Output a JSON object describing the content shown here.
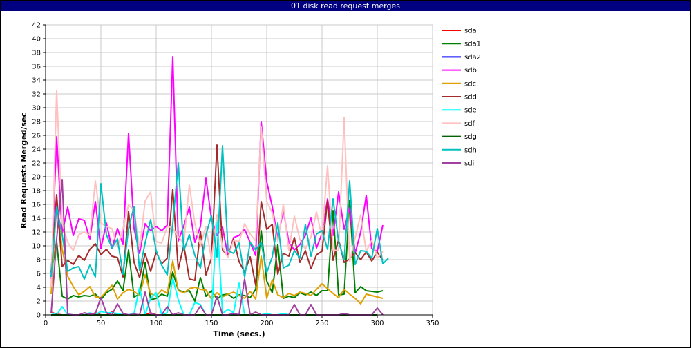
{
  "window": {
    "title": "01 disk read request merges"
  },
  "chart_data": {
    "type": "line",
    "title": "01 disk read request merges",
    "xlabel": "Time (secs.)",
    "ylabel": "Read Requests Merged/sec",
    "xlim": [
      0,
      350
    ],
    "ylim": [
      0,
      42
    ],
    "xticks": [
      0,
      50,
      100,
      150,
      200,
      250,
      300,
      350
    ],
    "yticks": [
      0,
      2,
      4,
      6,
      8,
      10,
      12,
      14,
      16,
      18,
      20,
      22,
      24,
      26,
      28,
      30,
      32,
      34,
      36,
      38,
      40,
      42
    ],
    "grid": true,
    "legend": "right",
    "x": [
      5,
      10,
      15,
      20,
      25,
      30,
      35,
      40,
      45,
      50,
      55,
      60,
      65,
      70,
      75,
      80,
      85,
      90,
      95,
      100,
      105,
      110,
      115,
      120,
      125,
      130,
      135,
      140,
      145,
      150,
      155,
      160,
      165,
      170,
      175,
      180,
      185,
      190,
      195,
      200,
      205,
      210,
      215,
      220,
      225,
      230,
      235,
      240,
      245,
      250,
      255,
      260,
      265,
      270,
      275,
      280,
      285,
      290,
      295,
      300,
      305,
      310
    ],
    "series": [
      {
        "name": "sda",
        "color": "#ff0000",
        "values": [
          0.4,
          0.1,
          0,
          0,
          0,
          0,
          0,
          0,
          0.3,
          0,
          0,
          0.4,
          0,
          0,
          0,
          0.1,
          0,
          0,
          0.3,
          0,
          0,
          0,
          0,
          0,
          0,
          0,
          0,
          0,
          0,
          0,
          0,
          0,
          0,
          0,
          0,
          0,
          0,
          0,
          0,
          0,
          0,
          0,
          0,
          0,
          0,
          0,
          0,
          0,
          0,
          0,
          0,
          0,
          0,
          0,
          0,
          0,
          0,
          0,
          0,
          0,
          null,
          null
        ]
      },
      {
        "name": "sda1",
        "color": "#008000",
        "values": [
          6,
          10.6,
          2.7,
          2.3,
          2.8,
          2.6,
          2.8,
          2.7,
          3,
          2.2,
          3.2,
          3.7,
          4.9,
          3.5,
          9.4,
          2.6,
          3,
          7.6,
          2.2,
          2.4,
          3,
          2.7,
          6.2,
          3.6,
          3.3,
          3.5,
          2,
          5.4,
          2.7,
          3.5,
          2.3,
          2.9,
          3,
          2.4,
          2.9,
          2.8,
          2.5,
          3.7,
          12.2,
          4.9,
          3.2,
          10.2,
          2.4,
          2.7,
          2.5,
          3.2,
          2.9,
          3.3,
          2.8,
          3.5,
          3.5,
          15.1,
          2.9,
          3,
          16.6,
          3.2,
          4.1,
          3.5,
          3.4,
          3.3,
          3.5,
          null
        ]
      },
      {
        "name": "sda2",
        "color": "#0000ff",
        "values": [
          0,
          0,
          0,
          0,
          0,
          0,
          0,
          0,
          0,
          0,
          0,
          0,
          0,
          0,
          0,
          0,
          0,
          0,
          0,
          0,
          0,
          0,
          0,
          0,
          0,
          0,
          0,
          0,
          0,
          0,
          0,
          0,
          0,
          0,
          0,
          0,
          0,
          0,
          0,
          0,
          0,
          0,
          0,
          0,
          0,
          0,
          0,
          0,
          0,
          0,
          0,
          0,
          0,
          0,
          0,
          0,
          0,
          0,
          0,
          0,
          null,
          null
        ]
      },
      {
        "name": "sdb",
        "color": "#ff00ff",
        "values": [
          5.2,
          25.8,
          11.8,
          15.6,
          11.5,
          13.9,
          13.7,
          11,
          16.4,
          9.6,
          13.3,
          9.6,
          12.5,
          10.2,
          26.3,
          12.5,
          8.9,
          13.2,
          12.2,
          12.8,
          12.2,
          13,
          37.4,
          10.7,
          12.9,
          15.6,
          10.5,
          12.8,
          19.8,
          13.9,
          11.5,
          12.7,
          8.4,
          11.2,
          11.5,
          12.4,
          10.5,
          8.6,
          28,
          19.3,
          15.7,
          11,
          15.2,
          10.5,
          9.4,
          10.2,
          11.5,
          14.1,
          9.7,
          11.8,
          16.8,
          11.5,
          17.8,
          12.4,
          15.5,
          8.9,
          12,
          17.3,
          9.6,
          9.2,
          13,
          null
        ]
      },
      {
        "name": "sdc",
        "color": "#e0a000",
        "values": [
          3,
          16.5,
          9.5,
          5.6,
          4.1,
          2.9,
          3.4,
          4.1,
          2.6,
          2.5,
          3.4,
          4.3,
          2.3,
          3.2,
          3.7,
          3.4,
          2.8,
          5.8,
          3.1,
          2.7,
          3.6,
          3.1,
          7.8,
          3.5,
          3.2,
          3.8,
          4,
          3.7,
          3.6,
          2.3,
          3.2,
          2.6,
          3,
          3.3,
          2.8,
          2.4,
          3.4,
          2.3,
          8.5,
          2.4,
          5.1,
          2.9,
          2.5,
          3.1,
          2.8,
          3.3,
          3.1,
          2.8,
          3.7,
          4.5,
          3.8,
          3.1,
          2.5,
          3.7,
          3,
          2.4,
          1.6,
          3,
          2.8,
          2.6,
          2.4,
          null
        ]
      },
      {
        "name": "sdd",
        "color": "#a52a2a",
        "values": [
          6.2,
          17.4,
          7,
          7.9,
          7.3,
          8.6,
          7.9,
          9.5,
          10.3,
          8.7,
          9.5,
          8.5,
          8.3,
          5.5,
          15,
          7.6,
          5.4,
          8.9,
          6.3,
          9.1,
          7.4,
          8.2,
          18.2,
          6.6,
          10.1,
          5.2,
          5,
          12.1,
          5.8,
          8.2,
          24.6,
          9.4,
          8.5,
          11,
          7.7,
          6.2,
          8.4,
          4.3,
          16.4,
          12.4,
          13.1,
          5.9,
          8.9,
          8.5,
          11.2,
          7.6,
          9.3,
          6.7,
          8.7,
          9.2,
          16.5,
          7.9,
          10.9,
          7.6,
          8.1,
          9,
          8,
          9.1,
          7.8,
          9.1,
          7.9,
          null
        ]
      },
      {
        "name": "sde",
        "color": "#00ffff",
        "values": [
          0.3,
          0,
          1.2,
          0,
          0,
          0,
          0,
          0.3,
          0,
          0.5,
          0.3,
          0.3,
          0.2,
          0,
          0,
          0.2,
          4,
          0,
          2.4,
          3.2,
          0,
          0.3,
          5.3,
          2.2,
          0,
          0,
          1.8,
          1.5,
          0,
          0,
          14.2,
          0.2,
          0.8,
          0.3,
          4.6,
          0,
          0,
          0,
          0,
          0.2,
          0,
          0,
          0.2,
          0,
          0,
          0,
          0,
          0,
          0,
          0,
          0,
          0,
          0,
          0,
          0,
          0,
          0,
          0,
          0,
          0,
          null,
          null
        ]
      },
      {
        "name": "sdf",
        "color": "#ffc0c0",
        "values": [
          4.1,
          32.5,
          13.3,
          10.5,
          9.3,
          11.6,
          12,
          11.5,
          19.4,
          13.3,
          12.8,
          12.5,
          9.8,
          12.5,
          15.9,
          15.2,
          9.5,
          16.5,
          17.8,
          10.6,
          10.4,
          12.8,
          12.6,
          11.3,
          10.4,
          18.8,
          13.2,
          10,
          12.8,
          8,
          14.5,
          9.8,
          8.3,
          10.8,
          10.6,
          13.2,
          11.7,
          10.7,
          27.2,
          16.4,
          14.8,
          10.6,
          16,
          9.3,
          14.3,
          10.9,
          9.5,
          11.3,
          14.9,
          11.2,
          21.6,
          9.4,
          9.3,
          28.6,
          7.7,
          11.2,
          14.5,
          9.2,
          10.8,
          8.2,
          9.2,
          null
        ]
      },
      {
        "name": "sdg",
        "color": "#006400",
        "values": [
          0,
          0,
          0,
          0,
          0,
          0,
          0,
          0,
          0,
          0,
          0,
          0,
          0,
          0,
          0,
          0,
          0,
          0,
          0,
          0,
          0,
          0,
          0,
          0,
          0,
          0,
          0,
          0,
          0,
          0,
          0,
          0,
          0,
          0,
          0,
          0,
          0,
          0,
          0,
          0,
          0,
          0,
          0,
          0,
          0,
          0,
          0,
          0,
          0,
          0,
          0,
          0,
          0,
          0,
          0,
          0,
          0,
          0,
          0,
          0,
          null,
          null
        ]
      },
      {
        "name": "sdh",
        "color": "#00c0c0",
        "values": [
          5.5,
          15.7,
          11.6,
          6.3,
          6.8,
          7,
          5.2,
          7.2,
          5.5,
          19,
          11.6,
          9.7,
          11,
          5.9,
          12.5,
          15.7,
          6.4,
          10.4,
          13.8,
          9.3,
          7.2,
          5.8,
          13.2,
          22,
          9.3,
          11.6,
          8.6,
          6.8,
          11.6,
          14.4,
          8.4,
          24.5,
          9.3,
          8.9,
          10.4,
          5.5,
          10.5,
          9.4,
          10.5,
          6.1,
          8.4,
          13.3,
          6.8,
          7.2,
          9.3,
          8.2,
          13.1,
          8.5,
          11.7,
          12.2,
          9.5,
          16.8,
          10.6,
          8,
          19.4,
          7.3,
          9.3,
          9.2,
          8.2,
          12.5,
          7.4,
          8.2
        ]
      },
      {
        "name": "sdi",
        "color": "#a040a0",
        "values": [
          0.2,
          11,
          19.6,
          0.1,
          0,
          0,
          0.3,
          0.1,
          0.2,
          2.5,
          0.3,
          0,
          1.6,
          0.2,
          0,
          0.1,
          0,
          3.3,
          0.2,
          0,
          0,
          1.2,
          0,
          0.3,
          0,
          0,
          0,
          1.3,
          0,
          0,
          2.7,
          0,
          0,
          0.2,
          0,
          5.2,
          0,
          0.4,
          0,
          0,
          0,
          0,
          0,
          0,
          1.5,
          0,
          0,
          1.5,
          0,
          0,
          0,
          0,
          0,
          0.2,
          0,
          0,
          0,
          0,
          0,
          1,
          0,
          null
        ]
      }
    ]
  }
}
